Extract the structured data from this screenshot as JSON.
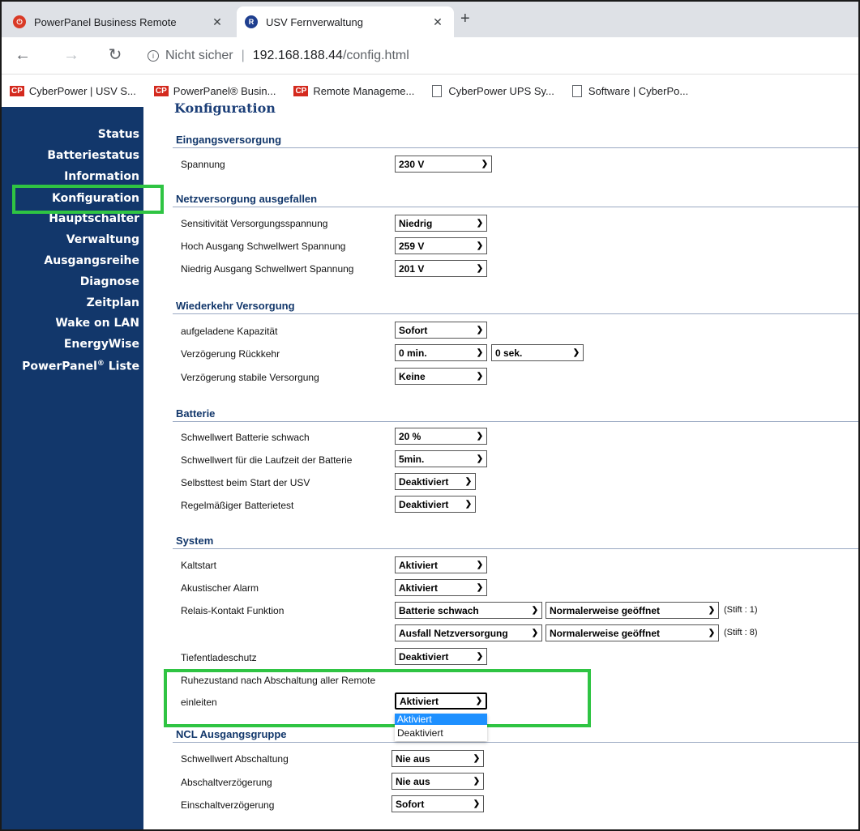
{
  "browser": {
    "tabs": [
      {
        "title": "PowerPanel Business Remote",
        "icon": "powerpanel-icon",
        "active": false
      },
      {
        "title": "USV Fernverwaltung",
        "icon": "rmcard-icon",
        "active": true
      }
    ],
    "new_tab_label": "+",
    "address": {
      "security": "Nicht sicher",
      "separator": "|",
      "host": "192.168.188.44",
      "path": "/config.html"
    },
    "bookmarks": [
      {
        "label": "CyberPower | USV S...",
        "icon": "cp"
      },
      {
        "label": "PowerPanel® Busin...",
        "icon": "cp"
      },
      {
        "label": "Remote Manageme...",
        "icon": "cp"
      },
      {
        "label": "CyberPower UPS Sy...",
        "icon": "doc"
      },
      {
        "label": "Software | CyberPo...",
        "icon": "doc"
      }
    ]
  },
  "sidebar": {
    "items": [
      {
        "label": "Status"
      },
      {
        "label": "Batteriestatus"
      },
      {
        "label": "Information"
      },
      {
        "label": "Konfiguration",
        "selected": true
      },
      {
        "label": "Hauptschalter"
      },
      {
        "label": "Verwaltung"
      },
      {
        "label": "Ausgangsreihe"
      },
      {
        "label": "Diagnose"
      },
      {
        "label": "Zeitplan"
      },
      {
        "label": "Wake on LAN"
      },
      {
        "label": "EnergyWise"
      },
      {
        "label": "PowerPanel",
        "sup": "®",
        "suffix": " Liste"
      }
    ]
  },
  "main": {
    "heading": "Konfiguration",
    "sections": {
      "input": {
        "title": "Eingangsversorgung",
        "rows": [
          {
            "label": "Spannung",
            "value": "230 V"
          }
        ]
      },
      "outage": {
        "title": "Netzversorgung ausgefallen",
        "rows": [
          {
            "label": "Sensitivität Versorgungsspannung",
            "value": "Niedrig"
          },
          {
            "label": "Hoch Ausgang Schwellwert Spannung",
            "value": "259 V"
          },
          {
            "label": "Niedrig Ausgang Schwellwert Spannung",
            "value": "201 V"
          }
        ]
      },
      "restore": {
        "title": "Wiederkehr Versorgung",
        "rows": [
          {
            "label": "aufgeladene Kapazität",
            "value": "Sofort"
          },
          {
            "label": "Verzögerung Rückkehr",
            "value": "0 min.",
            "value2": "0 sek."
          },
          {
            "label": "Verzögerung stabile Versorgung",
            "value": "Keine"
          }
        ]
      },
      "battery": {
        "title": "Batterie",
        "rows": [
          {
            "label": "Schwellwert Batterie schwach",
            "value": "20 %"
          },
          {
            "label": "Schwellwert für die Laufzeit der Batterie",
            "value": "5min."
          },
          {
            "label": "Selbsttest beim Start der USV",
            "value": "Deaktiviert"
          },
          {
            "label": "Regelmäßiger Batterietest",
            "value": "Deaktiviert"
          }
        ]
      },
      "system": {
        "title": "System",
        "rows": [
          {
            "label": "Kaltstart",
            "value": "Aktiviert"
          },
          {
            "label": "Akustischer Alarm",
            "value": "Aktiviert"
          },
          {
            "label": "Relais-Kontakt Funktion",
            "value": "Batterie schwach",
            "value2": "Normalerweise geöffnet",
            "pin": "(Stift : 1)"
          },
          {
            "label": "",
            "value": "Ausfall Netzversorgung",
            "value2": "Normalerweise geöffnet",
            "pin": "(Stift : 8)"
          },
          {
            "label": "Tiefentladeschutz",
            "value": "Deaktiviert"
          },
          {
            "label": "Ruhezustand nach Abschaltung aller Remote",
            "label2": "einleiten",
            "value": "Aktiviert"
          }
        ],
        "dropdown_options": [
          "Aktiviert",
          "Deaktiviert"
        ]
      },
      "ncl": {
        "title": "NCL Ausgangsgruppe",
        "rows": [
          {
            "label": "Schwellwert Abschaltung",
            "value": "Nie aus"
          },
          {
            "label": "Abschaltverzögerung",
            "value": "Nie aus"
          },
          {
            "label": "Einschaltverzögerung",
            "value": "Sofort"
          }
        ]
      }
    }
  },
  "colors": {
    "sidebar_bg": "#12376b",
    "highlight_green": "#2fc443",
    "section_title": "#12376b",
    "dropdown_selected": "#1e90ff"
  }
}
